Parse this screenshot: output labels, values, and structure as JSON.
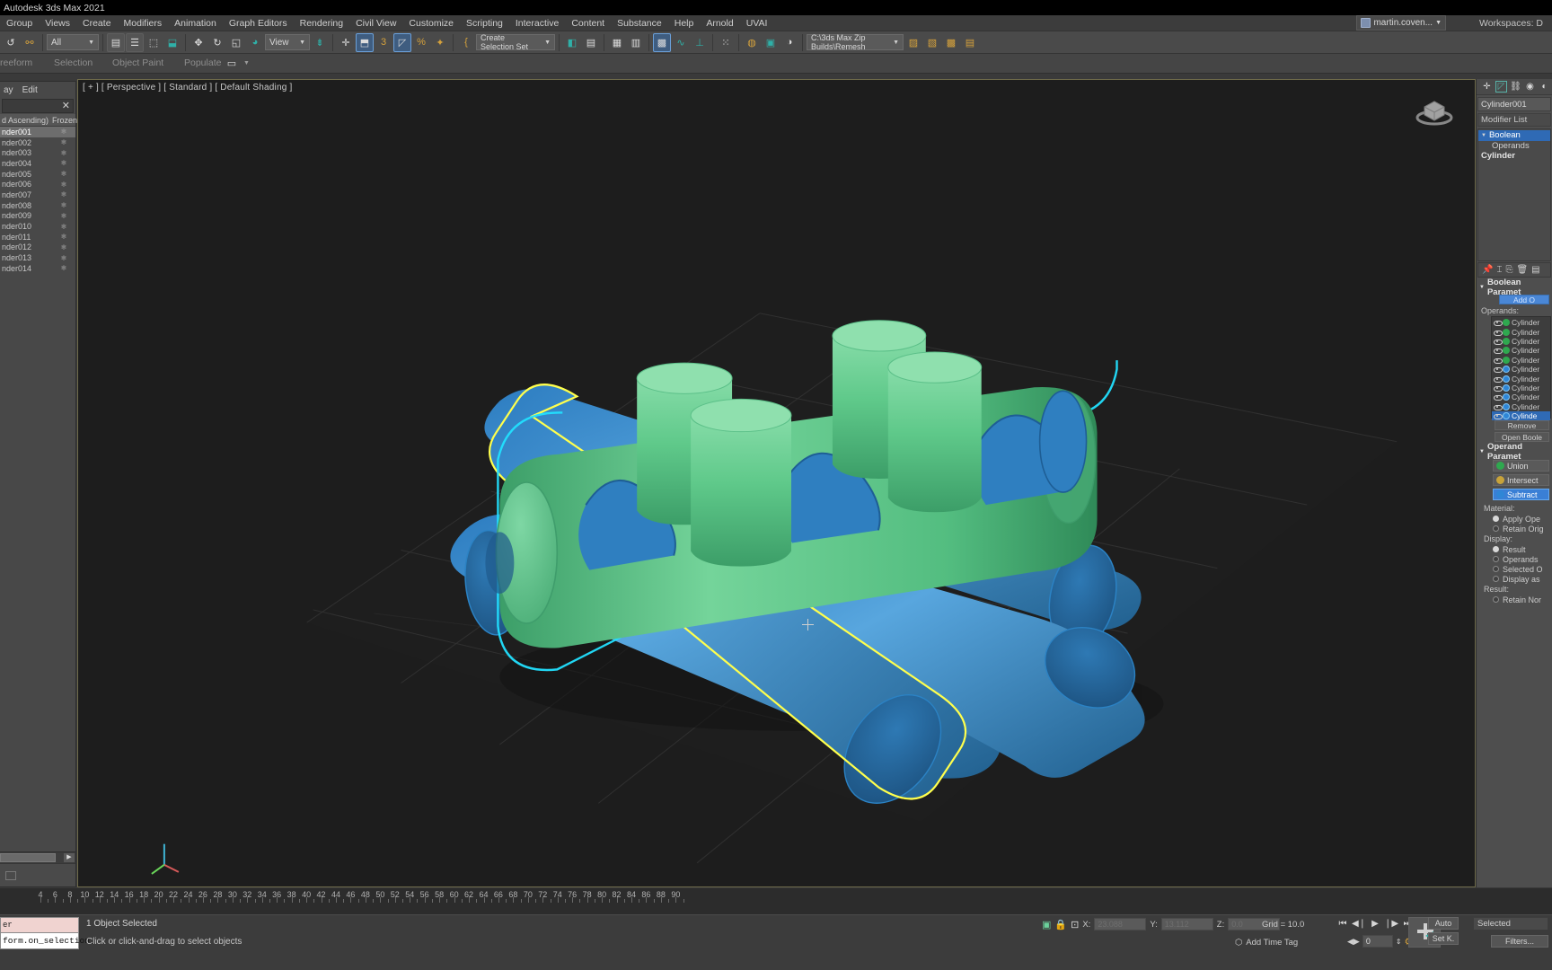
{
  "window": {
    "title": "Autodesk 3ds Max 2021"
  },
  "menu": {
    "items": [
      "Group",
      "Views",
      "Create",
      "Modifiers",
      "Animation",
      "Graph Editors",
      "Rendering",
      "Civil View",
      "Customize",
      "Scripting",
      "Interactive",
      "Content",
      "Substance",
      "Help",
      "Arnold",
      "UVAI"
    ],
    "user": "martin.coven...",
    "workspaces_label": "Workspaces: D"
  },
  "toolbar": {
    "selection_filter": "All",
    "reference_coord": "View",
    "named_selection_set": "Create Selection Set",
    "project_path": "C:\\3ds Max Zip Builds\\Remesh",
    "angle_snap_label": "3",
    "percent_label": "%"
  },
  "ribbon": {
    "tabs": [
      "reeform",
      "Selection",
      "Object Paint",
      "Populate"
    ]
  },
  "explorer": {
    "menu": [
      "ay",
      "Edit"
    ],
    "search_placeholder": "",
    "columns": [
      "d Ascending)",
      "Frozen"
    ],
    "sort_indicator": "▲",
    "rows": [
      {
        "name": "nder001",
        "frozen": "❄",
        "selected": true
      },
      {
        "name": "nder002",
        "frozen": "❄",
        "selected": false
      },
      {
        "name": "nder003",
        "frozen": "❄",
        "selected": false
      },
      {
        "name": "nder004",
        "frozen": "❄",
        "selected": false
      },
      {
        "name": "nder005",
        "frozen": "❄",
        "selected": false
      },
      {
        "name": "nder006",
        "frozen": "❄",
        "selected": false
      },
      {
        "name": "nder007",
        "frozen": "❄",
        "selected": false
      },
      {
        "name": "nder008",
        "frozen": "❄",
        "selected": false
      },
      {
        "name": "nder009",
        "frozen": "❄",
        "selected": false
      },
      {
        "name": "nder010",
        "frozen": "❄",
        "selected": false
      },
      {
        "name": "nder011",
        "frozen": "❄",
        "selected": false
      },
      {
        "name": "nder012",
        "frozen": "❄",
        "selected": false
      },
      {
        "name": "nder013",
        "frozen": "❄",
        "selected": false
      },
      {
        "name": "nder014",
        "frozen": "❄",
        "selected": false
      }
    ]
  },
  "viewport": {
    "label": "[ + ] [ Perspective ] [ Standard ] [ Default Shading ]",
    "colors": {
      "background": "#1d1d1d",
      "green_object": "#5fc98a",
      "blue_object": "#3f8fd0",
      "selection_outline": "#ffff4d",
      "highlight_outline": "#22e0ff",
      "grid": "#2e2e2e",
      "border": "#6e6a4a"
    }
  },
  "command_panel": {
    "object_name": "Cylinder001",
    "modifier_list_label": "Modifier List",
    "stack": [
      {
        "label": "Boolean",
        "selected": true,
        "indent": 0,
        "expandable": true
      },
      {
        "label": "Operands",
        "selected": false,
        "indent": 1,
        "expandable": false
      },
      {
        "label": "Cylinder",
        "selected": false,
        "indent": 0,
        "bold": true
      }
    ],
    "boolean_params": {
      "title": "Boolean Paramet",
      "add_operand_button": "Add O",
      "operands_label": "Operands:",
      "operands": [
        {
          "name": "Cylinder",
          "mode": "green",
          "selected": false
        },
        {
          "name": "Cylinder",
          "mode": "green",
          "selected": false
        },
        {
          "name": "Cylinder",
          "mode": "green",
          "selected": false
        },
        {
          "name": "Cylinder",
          "mode": "green",
          "selected": false
        },
        {
          "name": "Cylinder",
          "mode": "green",
          "selected": false
        },
        {
          "name": "Cylinder",
          "mode": "blue",
          "selected": false
        },
        {
          "name": "Cylinder",
          "mode": "blue",
          "selected": false
        },
        {
          "name": "Cylinder",
          "mode": "blue",
          "selected": false
        },
        {
          "name": "Cylinder",
          "mode": "blue",
          "selected": false
        },
        {
          "name": "Cylinder",
          "mode": "blue",
          "selected": false
        },
        {
          "name": "Cylinde",
          "mode": "blue",
          "selected": true
        }
      ],
      "remove_button": "Remove",
      "open_boolean_button": "Open Boole"
    },
    "operand_params": {
      "title": "Operand Paramet",
      "ops": [
        {
          "label": "Union",
          "selected": false
        },
        {
          "label": "Intersect",
          "selected": false
        },
        {
          "label": "Subtract",
          "selected": true
        }
      ],
      "material_label": "Material:",
      "material_options": [
        {
          "label": "Apply Ope",
          "selected": true
        },
        {
          "label": "Retain Orig",
          "selected": false
        }
      ],
      "display_label": "Display:",
      "display_options": [
        {
          "label": "Result",
          "selected": true
        },
        {
          "label": "Operands",
          "selected": false
        },
        {
          "label": "Selected O",
          "selected": false
        },
        {
          "label": "Display as",
          "selected": false
        }
      ],
      "result_label": "Result:",
      "result_options": [
        {
          "label": "Retain Nor",
          "selected": false
        }
      ]
    }
  },
  "timeline": {
    "ticks": [
      4,
      6,
      8,
      10,
      12,
      14,
      16,
      18,
      20,
      22,
      24,
      26,
      28,
      30,
      32,
      34,
      36,
      38,
      40,
      42,
      44,
      46,
      48,
      50,
      52,
      54,
      56,
      58,
      60,
      62,
      64,
      66,
      68,
      70,
      72,
      74,
      76,
      78,
      80,
      82,
      84,
      86,
      88,
      90
    ]
  },
  "status": {
    "maxscript_top": "er",
    "maxscript_bottom": "form.on_selection_",
    "selection_text": "1 Object Selected",
    "hint_text": "Click or click-and-drag to select objects",
    "coords": [
      {
        "label": "X:",
        "value": "23.088"
      },
      {
        "label": "Y:",
        "value": "13.112"
      },
      {
        "label": "Z:",
        "value": "0.0"
      }
    ],
    "grid_text": "Grid = 10.0",
    "add_time_tag": "Add Time Tag",
    "frame_value": "0",
    "auto_key": "Auto",
    "set_key": "Set K.",
    "key_filter_target": "Selected",
    "filters_button": "Filters..."
  }
}
